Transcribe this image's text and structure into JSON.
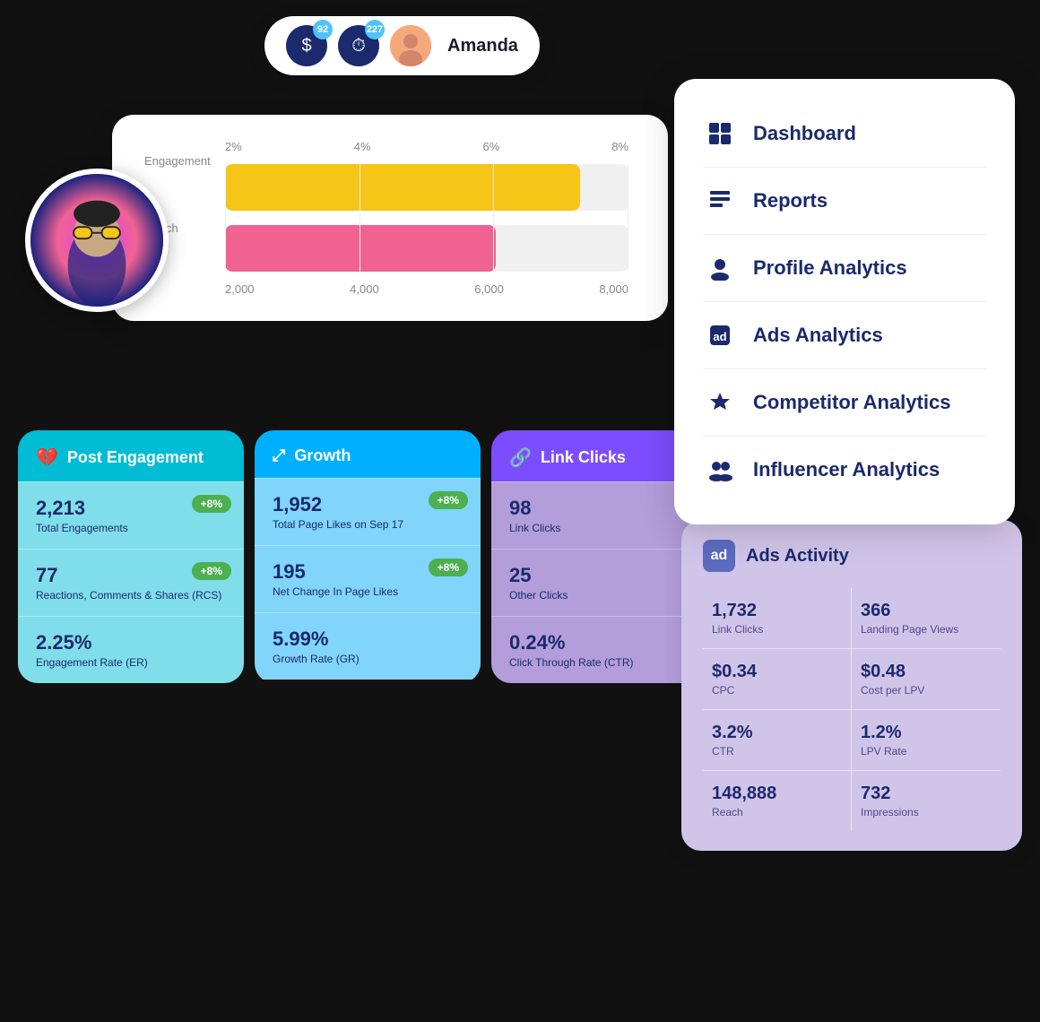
{
  "header": {
    "badge1": {
      "count": "92",
      "icon": "$"
    },
    "badge2": {
      "count": "227",
      "icon": "⏱"
    },
    "user": {
      "name": "Amanda"
    }
  },
  "nav": {
    "items": [
      {
        "id": "dashboard",
        "label": "Dashboard",
        "icon": "⊞"
      },
      {
        "id": "reports",
        "label": "Reports",
        "icon": "📋"
      },
      {
        "id": "profile-analytics",
        "label": "Profile Analytics",
        "icon": "👤"
      },
      {
        "id": "ads-analytics",
        "label": "Ads Analytics",
        "icon": "ad"
      },
      {
        "id": "competitor-analytics",
        "label": "Competitor Analytics",
        "icon": "🏆"
      },
      {
        "id": "influencer-analytics",
        "label": "Influencer Analytics",
        "icon": "👥"
      }
    ]
  },
  "chart": {
    "top_labels": [
      "Engagement",
      "2%",
      "4%",
      "6%",
      "8%"
    ],
    "bottom_labels": [
      "Reach",
      "2,000",
      "4,000",
      "6,000",
      "8,000"
    ],
    "bar1_width": "88%",
    "bar2_width": "67%"
  },
  "stats": [
    {
      "id": "post-engagement",
      "color": "teal",
      "header_label": "Post Engagement",
      "header_icon": "💔",
      "rows": [
        {
          "value": "2,213",
          "desc": "Total Engagements",
          "badge": "+8%"
        },
        {
          "value": "77",
          "desc": "Reactions, Comments & Shares (RCS)",
          "badge": "+8%"
        },
        {
          "value": "2.25%",
          "desc": "Engagement Rate (ER)",
          "badge": null
        }
      ]
    },
    {
      "id": "growth",
      "color": "blue",
      "header_label": "Growth",
      "header_icon": "⤢",
      "rows": [
        {
          "value": "1,952",
          "desc": "Total Page Likes on Sep 17",
          "badge": "+8%"
        },
        {
          "value": "195",
          "desc": "Net Change In Page Likes",
          "badge": "+8%"
        },
        {
          "value": "5.99%",
          "desc": "Growth Rate (GR)",
          "badge": null
        }
      ]
    },
    {
      "id": "link-clicks",
      "color": "purple",
      "header_label": "Link Clicks",
      "header_icon": "🔗",
      "rows": [
        {
          "value": "98",
          "desc": "Link Clicks",
          "badge": null
        },
        {
          "value": "25",
          "desc": "Other Clicks",
          "badge": null
        },
        {
          "value": "0.24%",
          "desc": "Click Through Rate (CTR)",
          "badge": null
        }
      ]
    }
  ],
  "ads_activity": {
    "title": "Ads Activity",
    "cells": [
      {
        "value": "1,732",
        "label": "Link Clicks"
      },
      {
        "value": "366",
        "label": "Landing Page Views"
      },
      {
        "value": "$0.34",
        "label": "CPC"
      },
      {
        "value": "$0.48",
        "label": "Cost per LPV"
      },
      {
        "value": "3.2%",
        "label": "CTR"
      },
      {
        "value": "1.2%",
        "label": "LPV Rate"
      },
      {
        "value": "148,888",
        "label": "Reach"
      },
      {
        "value": "732",
        "label": "Impressions"
      }
    ]
  }
}
